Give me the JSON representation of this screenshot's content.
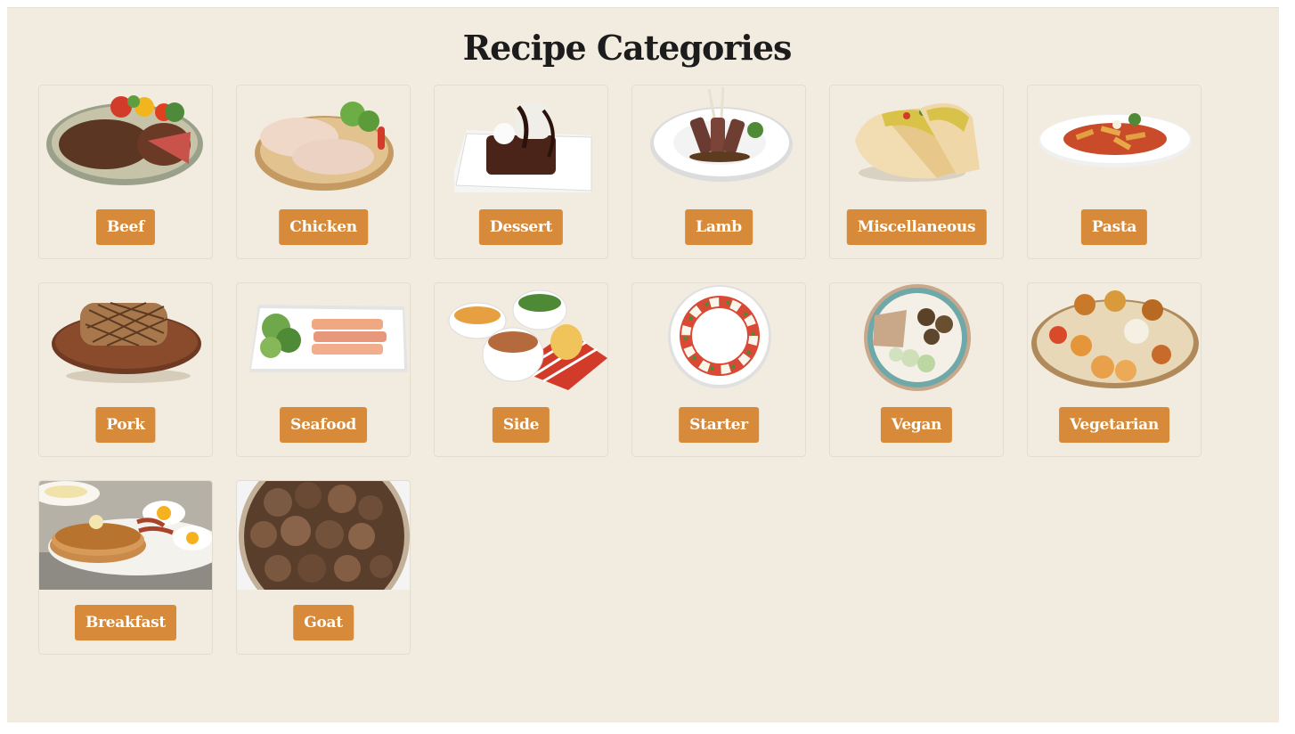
{
  "page": {
    "title": "Recipe Categories"
  },
  "categories": [
    {
      "name": "Beef",
      "image": "beef-steak-plate"
    },
    {
      "name": "Chicken",
      "image": "chicken-legs-plate"
    },
    {
      "name": "Dessert",
      "image": "chocolate-dessert-plate"
    },
    {
      "name": "Lamb",
      "image": "lamb-chops-plate"
    },
    {
      "name": "Miscellaneous",
      "image": "tacos"
    },
    {
      "name": "Pasta",
      "image": "pasta-bowl"
    },
    {
      "name": "Pork",
      "image": "pork-chop-board"
    },
    {
      "name": "Seafood",
      "image": "salmon-platter"
    },
    {
      "name": "Side",
      "image": "side-dish-bowls"
    },
    {
      "name": "Starter",
      "image": "caprese-plate"
    },
    {
      "name": "Vegan",
      "image": "vegan-bowl"
    },
    {
      "name": "Vegetarian",
      "image": "vegetarian-thali"
    },
    {
      "name": "Breakfast",
      "image": "pancakes-eggs-bacon"
    },
    {
      "name": "Goat",
      "image": "goat-meat-bowl"
    }
  ],
  "colors": {
    "background": "#f2ece0",
    "accent": "#d68a3a",
    "title": "#1c1c1c"
  }
}
